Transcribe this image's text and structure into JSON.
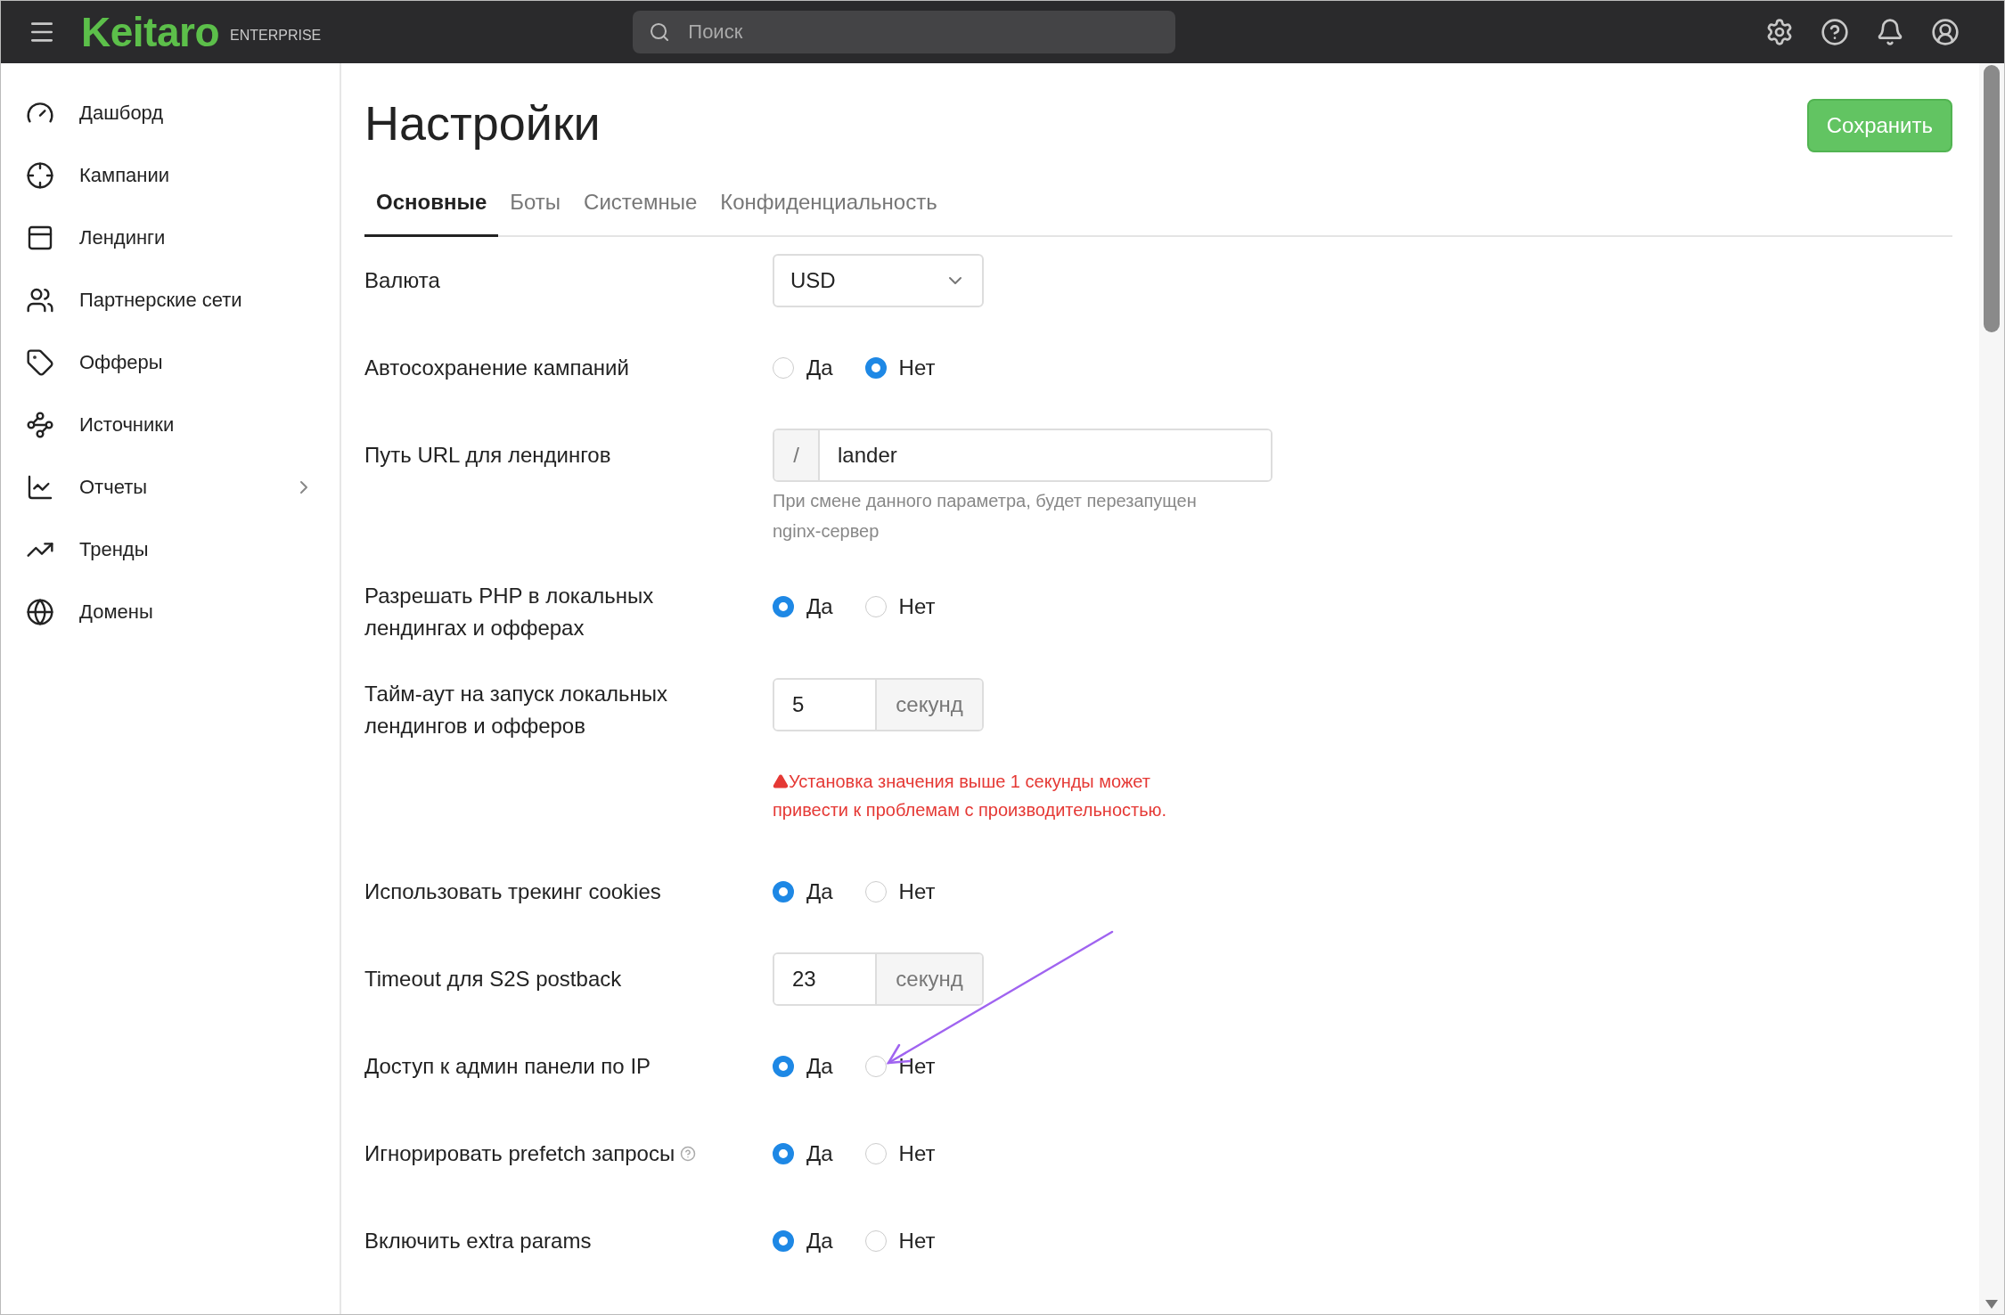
{
  "header": {
    "logo": "Keitaro",
    "edition": "ENTERPRISE",
    "search": {
      "placeholder": "Поиск"
    }
  },
  "sidebar": {
    "items": [
      {
        "label": "Дашборд",
        "expandable": false
      },
      {
        "label": "Кампании",
        "expandable": false
      },
      {
        "label": "Лендинги",
        "expandable": false
      },
      {
        "label": "Партнерские сети",
        "expandable": false
      },
      {
        "label": "Офферы",
        "expandable": false
      },
      {
        "label": "Источники",
        "expandable": false
      },
      {
        "label": "Отчеты",
        "expandable": true
      },
      {
        "label": "Тренды",
        "expandable": false
      },
      {
        "label": "Домены",
        "expandable": false
      }
    ]
  },
  "page": {
    "title": "Настройки",
    "save_button": "Сохранить"
  },
  "tabs": [
    {
      "label": "Основные",
      "selected": true
    },
    {
      "label": "Боты",
      "selected": false
    },
    {
      "label": "Системные",
      "selected": false
    },
    {
      "label": "Конфиденциальность",
      "selected": false
    }
  ],
  "settings": [
    {
      "kind": "select",
      "label": "Валюта",
      "value": "USD"
    },
    {
      "kind": "radio",
      "label": "Автосохранение кампаний",
      "options": [
        {
          "label": "Да",
          "selected": false
        },
        {
          "label": "Нет",
          "selected": true
        }
      ]
    },
    {
      "kind": "prefix_input",
      "label": "Путь URL для лендингов",
      "prefix": "/",
      "value": "lander",
      "hint": "При смене данного параметра, будет перезапущен nginx-сервер"
    },
    {
      "kind": "radio",
      "label": "Разрешать PHP в локальных лендингах и офферах",
      "options": [
        {
          "label": "Да",
          "selected": true
        },
        {
          "label": "Нет",
          "selected": false
        }
      ]
    },
    {
      "kind": "suffix_input",
      "label": "Тайм-аут на запуск локальных лендингов и офферов",
      "value": "5",
      "suffix": "секунд",
      "warning": "Установка значения выше 1 секунды может привести к проблемам с производительностью."
    },
    {
      "kind": "radio",
      "label": "Использовать трекинг cookies",
      "options": [
        {
          "label": "Да",
          "selected": true
        },
        {
          "label": "Нет",
          "selected": false
        }
      ]
    },
    {
      "kind": "suffix_input",
      "label": "Timeout для S2S postback",
      "value": "23",
      "suffix": "секунд"
    },
    {
      "kind": "radio",
      "label": "Доступ к админ панели по IP",
      "options": [
        {
          "label": "Да",
          "selected": true
        },
        {
          "label": "Нет",
          "selected": false
        }
      ]
    },
    {
      "kind": "radio",
      "label": "Игнорировать prefetch запросы",
      "help": true,
      "options": [
        {
          "label": "Да",
          "selected": true
        },
        {
          "label": "Нет",
          "selected": false
        }
      ]
    },
    {
      "kind": "radio",
      "label": "Включить extra params",
      "options": [
        {
          "label": "Да",
          "selected": true
        },
        {
          "label": "Нет",
          "selected": false
        }
      ]
    }
  ]
}
